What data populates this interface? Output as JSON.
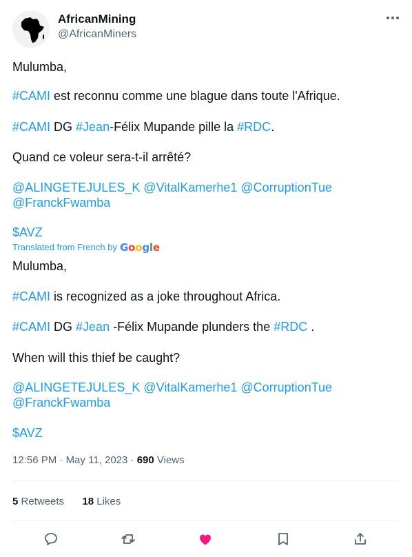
{
  "author": {
    "name": "AfricanMining",
    "handle": "@AfricanMiners",
    "avatar_icon": "africa-map-icon"
  },
  "original": {
    "greeting": "Mulumba,",
    "line1": {
      "tag": "#CAMI",
      "text": " est reconnu comme une blague dans toute l'Afrique."
    },
    "line2": {
      "tag1": "#CAMI",
      "text1": " DG ",
      "tag2": "#Jean",
      "text2": "-Félix Mupande pille la ",
      "tag3": "#RDC",
      "text3": "."
    },
    "question": "Quand ce voleur sera-t-il arrêté?",
    "mentions_row1": [
      "@ALINGETEJULES_K",
      "@VitalKamerhe1",
      "@CorruptionTue"
    ],
    "mentions_row2": "@FranckFwamba",
    "cashtag": "$AVZ"
  },
  "translation": {
    "label": "Translated from French by",
    "provider": "Google",
    "greeting": "Mulumba,",
    "line1": {
      "tag": "#CAMI",
      "text": " is recognized as a joke throughout Africa."
    },
    "line2": {
      "tag1": "#CAMI",
      "text1": " DG ",
      "tag2": "#Jean",
      "text2": " -Félix Mupande plunders the ",
      "tag3": "#RDC",
      "text3": " ."
    },
    "question": "When will this thief be caught?",
    "mentions_row1": [
      "@ALINGETEJULES_K",
      "@VitalKamerhe1",
      "@CorruptionTue"
    ],
    "mentions_row2": "@FranckFwamba",
    "cashtag": "$AVZ"
  },
  "meta": {
    "time": "12:56 PM",
    "date": "May 11, 2023",
    "views_count": "690",
    "views_label": "Views"
  },
  "stats": {
    "retweets_count": "5",
    "retweets_label": "Retweets",
    "likes_count": "18",
    "likes_label": "Likes"
  },
  "actions": [
    "reply-icon",
    "retweet-icon",
    "like-icon",
    "bookmark-icon",
    "share-icon"
  ],
  "colors": {
    "accent": "#1d9bf0",
    "like": "#f91880",
    "muted": "#536471",
    "text": "#0f1419"
  }
}
